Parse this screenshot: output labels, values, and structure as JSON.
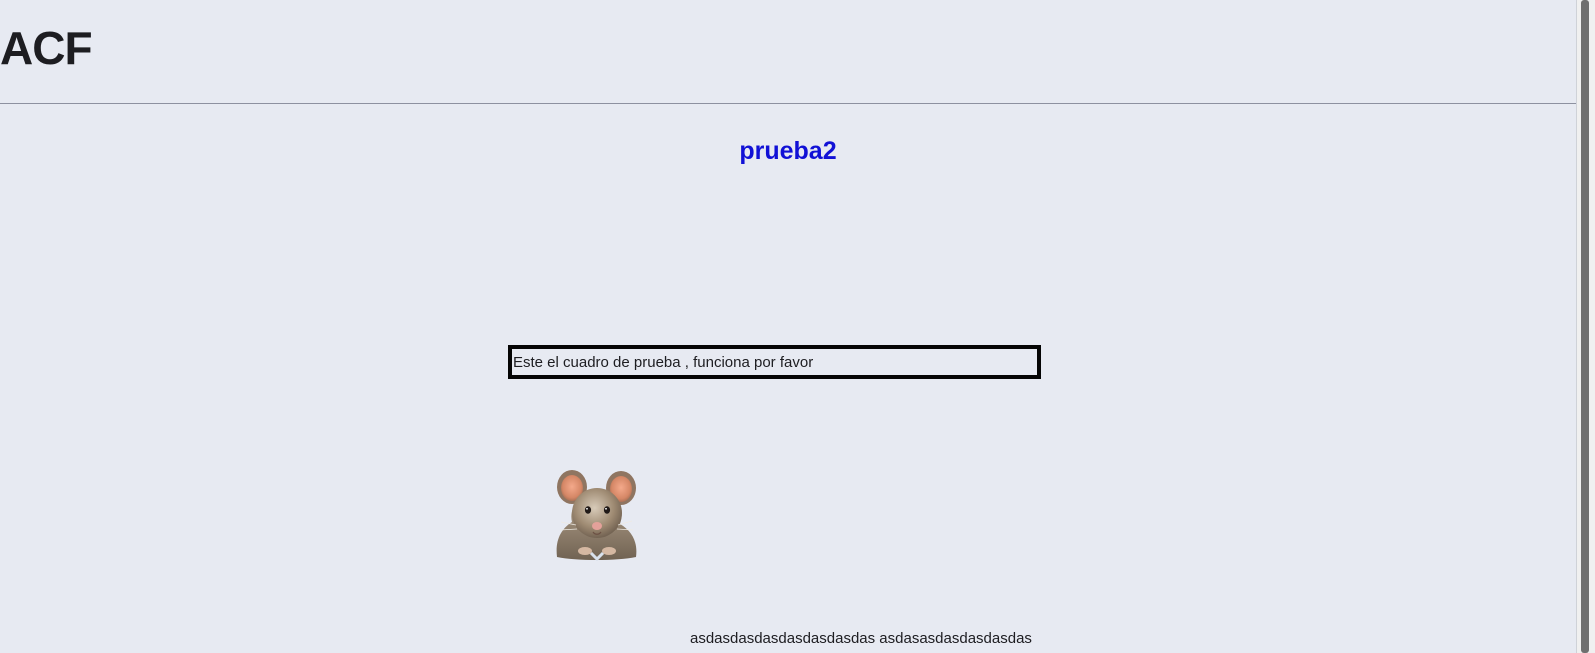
{
  "site": {
    "title": "ACF"
  },
  "post": {
    "title": "prueba2"
  },
  "test_box": {
    "text": "Este el cuadro de prueba , funciona por favor"
  },
  "footer": {
    "text": "asdasdasdasdasdasdasdas asdasasdasdasdasdas"
  },
  "colors": {
    "page_background": "#e7eaf2",
    "title_text": "#1d1d21",
    "post_title": "#1111d6",
    "box_border": "#050505",
    "divider": "#8d91a0"
  }
}
